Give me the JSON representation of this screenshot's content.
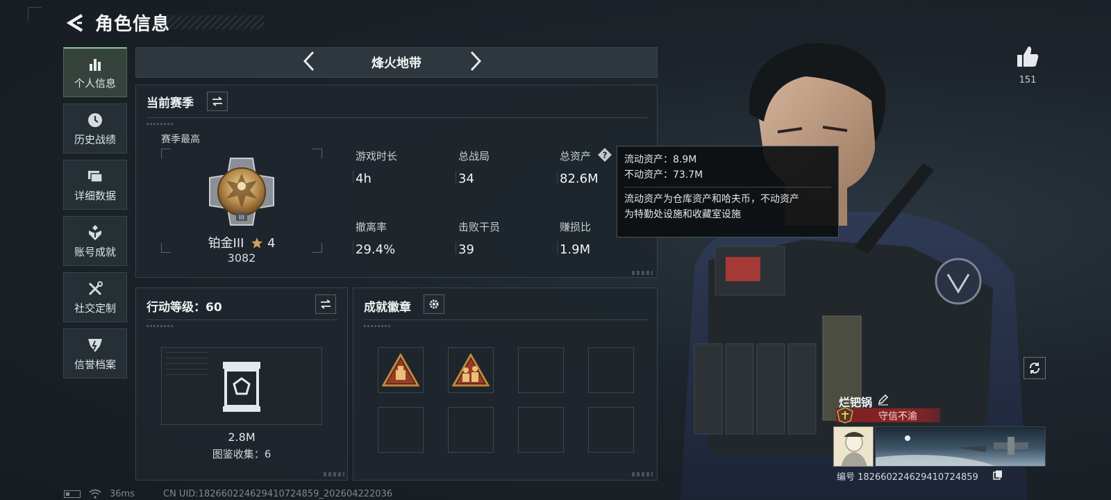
{
  "header": {
    "title": "角色信息"
  },
  "sidebar": {
    "items": [
      {
        "label": "个人信息",
        "icon": "bar-chart-icon",
        "active": true
      },
      {
        "label": "历史战绩",
        "icon": "clock-icon",
        "active": false
      },
      {
        "label": "详细数据",
        "icon": "folder-icon",
        "active": false
      },
      {
        "label": "账号成就",
        "icon": "achievement-icon",
        "active": false
      },
      {
        "label": "社交定制",
        "icon": "tools-icon",
        "active": false
      },
      {
        "label": "信誉档案",
        "icon": "shield-icon",
        "active": false
      }
    ]
  },
  "mode": {
    "title": "烽火地带"
  },
  "season": {
    "title": "当前赛季",
    "best_label": "赛季最高",
    "rank_name": "铂金III",
    "rank_stars": "4",
    "rank_score": "3082",
    "stats": [
      {
        "label": "游戏时长",
        "value": "4h"
      },
      {
        "label": "总战局",
        "value": "34"
      },
      {
        "label": "总资产",
        "value": "82.6M"
      },
      {
        "label": "撤离率",
        "value": "29.4%"
      },
      {
        "label": "击败干员",
        "value": "39"
      },
      {
        "label": "赚损比",
        "value": "1.9M"
      }
    ]
  },
  "tooltip": {
    "liquid": "流动资产：8.9M",
    "fixed": "不动资产：73.7M",
    "desc_line1": "流动资产为仓库资产和哈夫币，不动资产",
    "desc_line2": "为特勤处设施和收藏室设施"
  },
  "action_level": {
    "title": "行动等级：60",
    "collection_value": "2.8M",
    "collection_count": "图鉴收集：6"
  },
  "badges": {
    "title": "成就徽章"
  },
  "profile": {
    "like_count": "151",
    "player_name": "烂钯锅",
    "honor_title": "守信不渝",
    "player_id": "编号 182660224629410724859"
  },
  "status": {
    "ping": "36ms",
    "uid": "CN UID:182660224629410724859_202604222036"
  },
  "colors": {
    "accent_green": "#8ec79a",
    "honor_red": "#8c2426",
    "panel_bg": "#1e262c"
  }
}
